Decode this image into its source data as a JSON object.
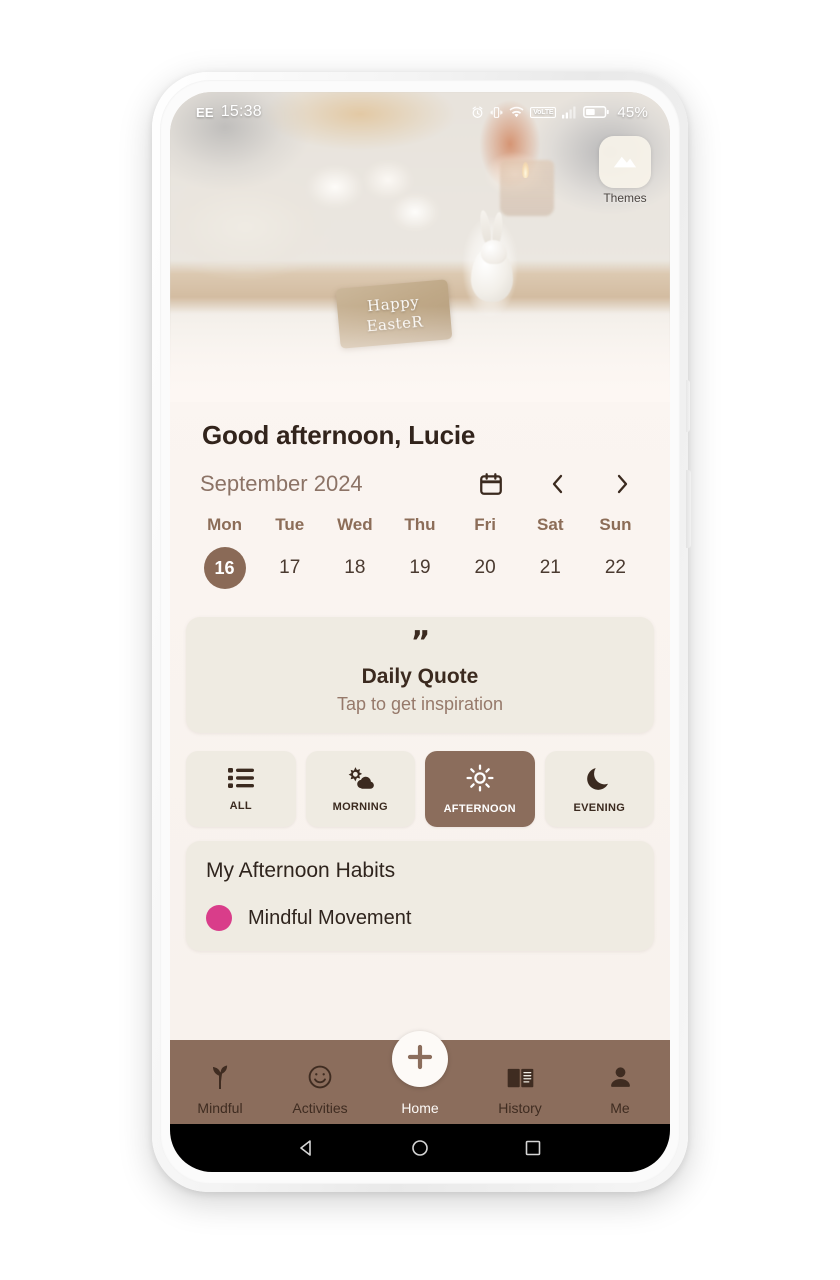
{
  "status_bar": {
    "carrier": "EE",
    "time": "15:38",
    "battery_percent": "45%",
    "icons": [
      "alarm-icon",
      "vibrate-icon",
      "wifi-icon",
      "volte-icon",
      "signal-icon",
      "battery-icon"
    ],
    "volte_text": "VoLTE"
  },
  "hero": {
    "sign_line1": "Happy",
    "sign_line2": "EasteR",
    "themes_label": "Themes",
    "themes_icon": "image-mountain-icon"
  },
  "greeting": "Good afternoon, Lucie",
  "calendar": {
    "month_label": "September 2024",
    "calendar_icon": "calendar-icon",
    "prev_icon": "chevron-left-icon",
    "next_icon": "chevron-right-icon",
    "day_names": [
      "Mon",
      "Tue",
      "Wed",
      "Thu",
      "Fri",
      "Sat",
      "Sun"
    ],
    "dates": [
      "16",
      "17",
      "18",
      "19",
      "20",
      "21",
      "22"
    ],
    "selected_date": "16",
    "selected_color": "#8a6a57"
  },
  "quote_card": {
    "quote_icon": "quote-mark-icon",
    "quote_glyph": "”",
    "title": "Daily Quote",
    "subtitle": "Tap to get inspiration"
  },
  "time_tabs": [
    {
      "label": "ALL",
      "icon": "list-icon",
      "active": false
    },
    {
      "label": "MORNING",
      "icon": "sun-cloud-icon",
      "active": false
    },
    {
      "label": "AFTERNOON",
      "icon": "sun-icon",
      "active": true
    },
    {
      "label": "EVENING",
      "icon": "moon-icon",
      "active": false
    }
  ],
  "habits": {
    "title": "My Afternoon Habits",
    "items": [
      {
        "name": "Mindful Movement",
        "color": "#d93d8a"
      }
    ]
  },
  "bottom_nav": {
    "items": [
      {
        "label": "Mindful",
        "icon": "sprout-icon"
      },
      {
        "label": "Activities",
        "icon": "smiley-icon"
      },
      {
        "label": "Home",
        "icon": "plus-icon"
      },
      {
        "label": "History",
        "icon": "book-icon"
      },
      {
        "label": "Me",
        "icon": "person-icon"
      }
    ],
    "accent_color": "#8b6d5c"
  },
  "android_nav": {
    "back_icon": "triangle-back-icon",
    "home_icon": "circle-home-icon",
    "recents_icon": "square-recents-icon"
  }
}
